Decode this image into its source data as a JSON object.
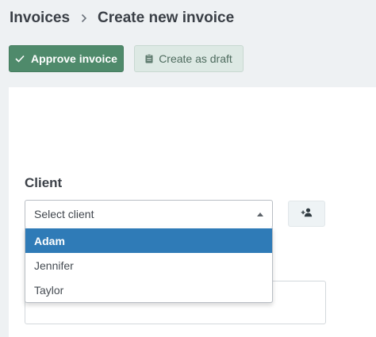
{
  "breadcrumb": {
    "parent": "Invoices",
    "current": "Create new invoice"
  },
  "toolbar": {
    "approve_label": "Approve invoice",
    "draft_label": "Create as draft"
  },
  "form": {
    "client_label": "Client",
    "client_select": {
      "placeholder": "Select client",
      "options": [
        "Adam",
        "Jennifer",
        "Taylor"
      ],
      "highlighted": "Adam"
    }
  },
  "icons": {
    "approve": "check-icon",
    "draft": "clipboard-icon",
    "breadcrumb_separator": "chevron-right-icon",
    "dropdown": "caret-up-icon",
    "add_client": "add-user-icon"
  },
  "colors": {
    "approve_button": "#4f8a6b",
    "draft_button": "#dde9e4",
    "highlight": "#2f7bb7",
    "background": "#eef1f3"
  }
}
